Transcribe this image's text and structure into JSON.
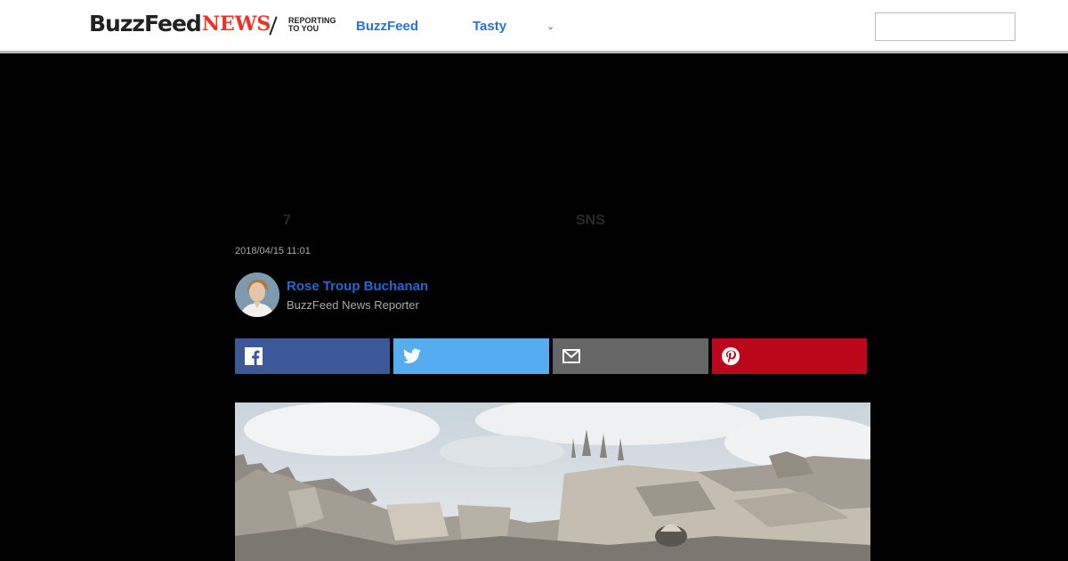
{
  "header": {
    "logo_buzzfeed": "BuzzFeed",
    "logo_news": "NEWS",
    "logo_tagline_line1": "REPORTING",
    "logo_tagline_line2": "TO YOU",
    "nav": [
      {
        "label": "BuzzFeed"
      },
      {
        "label": "Tasty"
      }
    ],
    "search": {
      "placeholder": "",
      "value": ""
    }
  },
  "article": {
    "headline_part1": "7",
    "headline_part2": "SNS",
    "timestamp": "2018/04/15 11:01",
    "author": {
      "name": "Rose Troup Buchanan",
      "role": "BuzzFeed News Reporter"
    }
  },
  "share": [
    {
      "network": "facebook",
      "icon": "facebook-icon",
      "color": "#3b5998"
    },
    {
      "network": "twitter",
      "icon": "twitter-icon",
      "color": "#55acee"
    },
    {
      "network": "email",
      "icon": "email-icon",
      "color": "#666666"
    },
    {
      "network": "pinterest",
      "icon": "pinterest-icon",
      "color": "#bd081c"
    }
  ],
  "colors": {
    "link_blue": "#2b73d1",
    "author_blue": "#2b63d6",
    "news_red": "#ee3322"
  }
}
